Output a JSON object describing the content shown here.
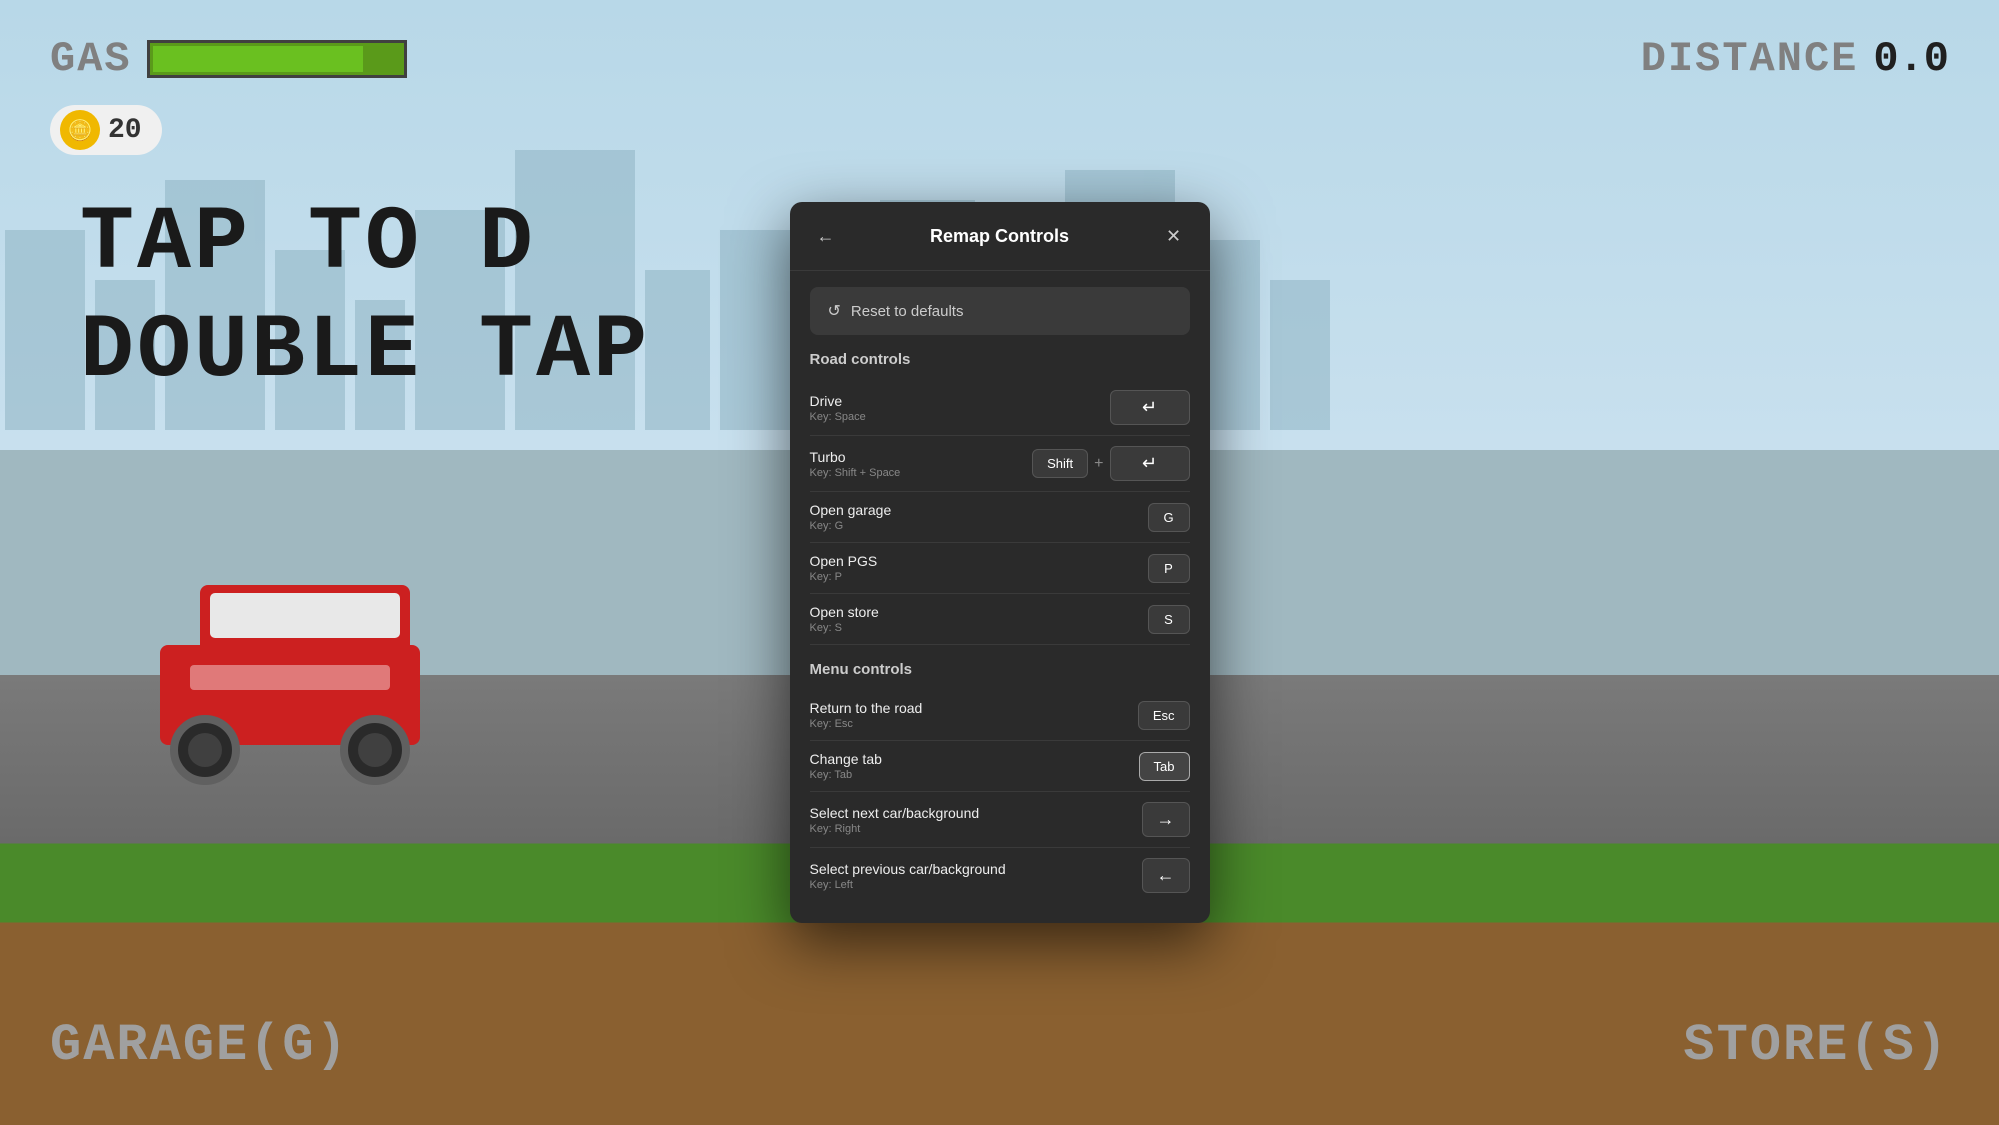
{
  "game": {
    "gas_label": "GAS",
    "distance_label": "DISTANCE",
    "distance_value": "0.0",
    "coin_count": "20",
    "tap_line1": "TAP TO D",
    "tap_line2": "DOUBLE TAP",
    "bottom_left": "GARAGE(G)",
    "bottom_right": "STORE(S)"
  },
  "modal": {
    "title": "Remap Controls",
    "back_label": "←",
    "close_label": "✕",
    "reset_label": "Reset to defaults",
    "road_controls_header": "Road controls",
    "menu_controls_header": "Menu controls",
    "controls": [
      {
        "id": "drive",
        "name": "Drive",
        "key_hint": "Key: Space",
        "keys": [
          {
            "label": "↵",
            "type": "wide"
          }
        ]
      },
      {
        "id": "turbo",
        "name": "Turbo",
        "key_hint": "Key: Shift + Space",
        "keys": [
          {
            "label": "Shift",
            "type": "normal"
          },
          {
            "label": "+",
            "type": "plus"
          },
          {
            "label": "↵",
            "type": "wide"
          }
        ]
      },
      {
        "id": "open_garage",
        "name": "Open garage",
        "key_hint": "Key: G",
        "keys": [
          {
            "label": "G",
            "type": "normal"
          }
        ]
      },
      {
        "id": "open_pgs",
        "name": "Open PGS",
        "key_hint": "Key: P",
        "keys": [
          {
            "label": "P",
            "type": "normal"
          }
        ]
      },
      {
        "id": "open_store",
        "name": "Open store",
        "key_hint": "Key: S",
        "keys": [
          {
            "label": "S",
            "type": "normal"
          }
        ]
      }
    ],
    "menu_controls": [
      {
        "id": "return_road",
        "name": "Return to the road",
        "key_hint": "Key: Esc",
        "keys": [
          {
            "label": "Esc",
            "type": "normal"
          }
        ]
      },
      {
        "id": "change_tab",
        "name": "Change tab",
        "key_hint": "Key: Tab",
        "keys": [
          {
            "label": "Tab",
            "type": "highlighted"
          }
        ]
      },
      {
        "id": "select_next",
        "name": "Select next car/background",
        "key_hint": "Key: Right",
        "keys": [
          {
            "label": "→",
            "type": "arrow"
          }
        ]
      },
      {
        "id": "select_prev",
        "name": "Select previous car/background",
        "key_hint": "Key: Left",
        "keys": [
          {
            "label": "←",
            "type": "arrow"
          }
        ]
      }
    ]
  }
}
